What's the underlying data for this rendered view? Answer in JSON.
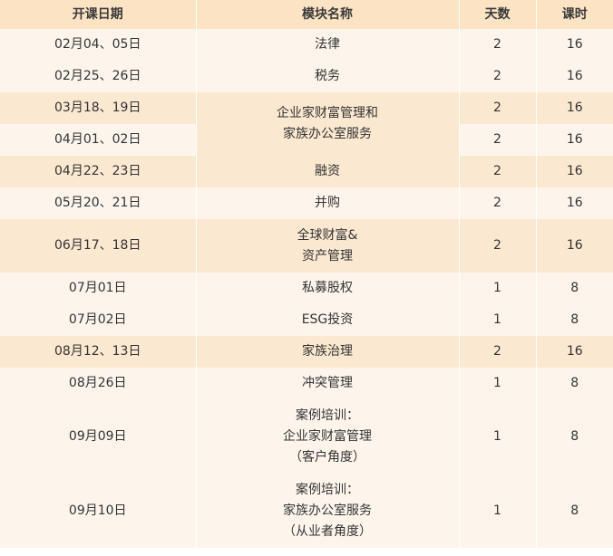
{
  "header": {
    "date": "开课日期",
    "module": "模块名称",
    "days": "天数",
    "hours": "课时"
  },
  "rows": [
    {
      "date": "02月04、05日",
      "module": [
        "法律"
      ],
      "days": "2",
      "hours": "16"
    },
    {
      "date": "02月25、26日",
      "module": [
        "税务"
      ],
      "days": "2",
      "hours": "16"
    },
    {
      "date": "03月18、19日",
      "module": [
        "企业家财富管理和",
        "家族办公室服务"
      ],
      "days": "2",
      "hours": "16"
    },
    {
      "date": "04月01、02日",
      "days": "2",
      "hours": "16"
    },
    {
      "date": "04月22、23日",
      "module": [
        "融资"
      ],
      "days": "2",
      "hours": "16"
    },
    {
      "date": "05月20、21日",
      "module": [
        "并购"
      ],
      "days": "2",
      "hours": "16"
    },
    {
      "date": "06月17、18日",
      "module": [
        "全球财富&",
        "资产管理"
      ],
      "days": "2",
      "hours": "16"
    },
    {
      "date": "07月01日",
      "module": [
        "私募股权"
      ],
      "days": "1",
      "hours": "8"
    },
    {
      "date": "07月02日",
      "module": [
        "ESG投资"
      ],
      "days": "1",
      "hours": "8"
    },
    {
      "date": "08月12、13日",
      "module": [
        "家族治理"
      ],
      "days": "2",
      "hours": "16"
    },
    {
      "date": "08月26日",
      "module": [
        "冲突管理"
      ],
      "days": "1",
      "hours": "8"
    },
    {
      "date": "09月09日",
      "module": [
        "案例培训：",
        "企业家财富管理",
        "（客户角度）"
      ],
      "days": "1",
      "hours": "8"
    },
    {
      "date": "09月10日",
      "module": [
        "案例培训：",
        "家族办公室服务",
        "（从业者角度）"
      ],
      "days": "1",
      "hours": "8"
    }
  ]
}
